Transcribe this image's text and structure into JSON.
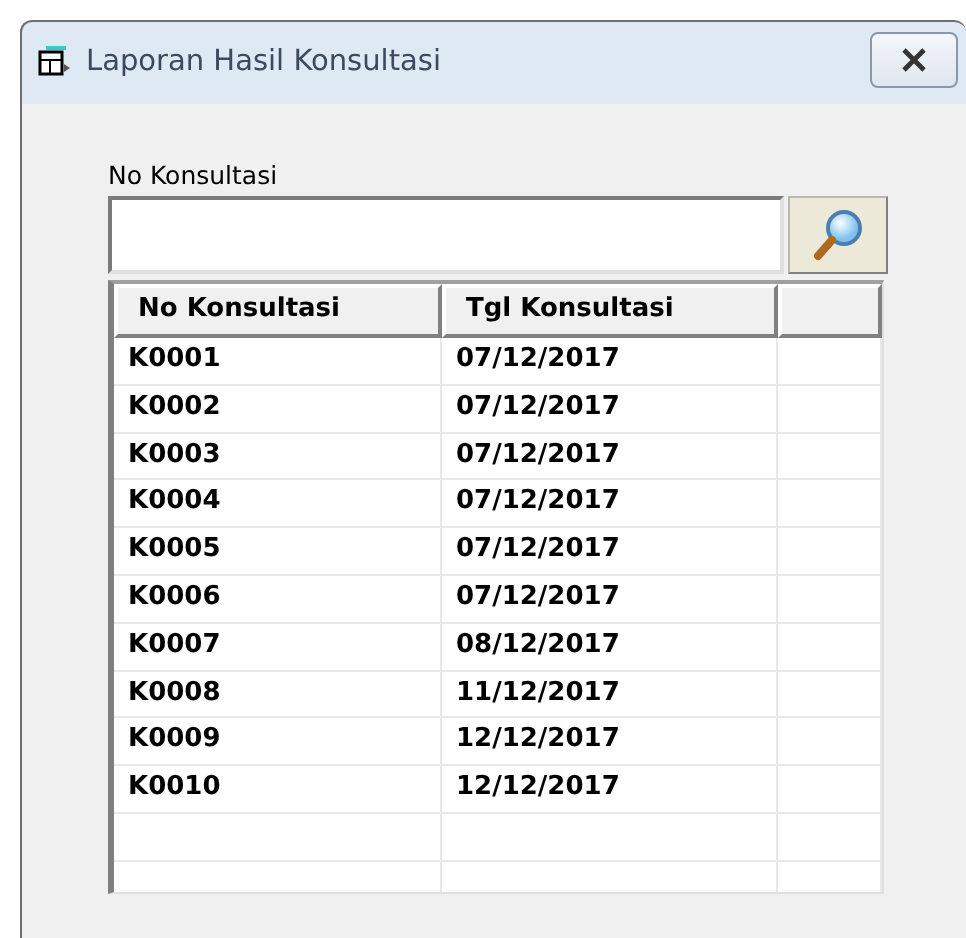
{
  "window": {
    "title": "Laporan Hasil Konsultasi"
  },
  "search": {
    "label": "No Konsultasi"
  },
  "table": {
    "columns": [
      "No Konsultasi",
      "Tgl Konsultasi"
    ],
    "rows": [
      {
        "no": "K0001",
        "tgl": "07/12/2017"
      },
      {
        "no": "K0002",
        "tgl": "07/12/2017"
      },
      {
        "no": "K0003",
        "tgl": "07/12/2017"
      },
      {
        "no": "K0004",
        "tgl": "07/12/2017"
      },
      {
        "no": "K0005",
        "tgl": "07/12/2017"
      },
      {
        "no": "K0006",
        "tgl": "07/12/2017"
      },
      {
        "no": "K0007",
        "tgl": "08/12/2017"
      },
      {
        "no": "K0008",
        "tgl": "11/12/2017"
      },
      {
        "no": "K0009",
        "tgl": "12/12/2017"
      },
      {
        "no": "K0010",
        "tgl": "12/12/2017"
      }
    ]
  }
}
